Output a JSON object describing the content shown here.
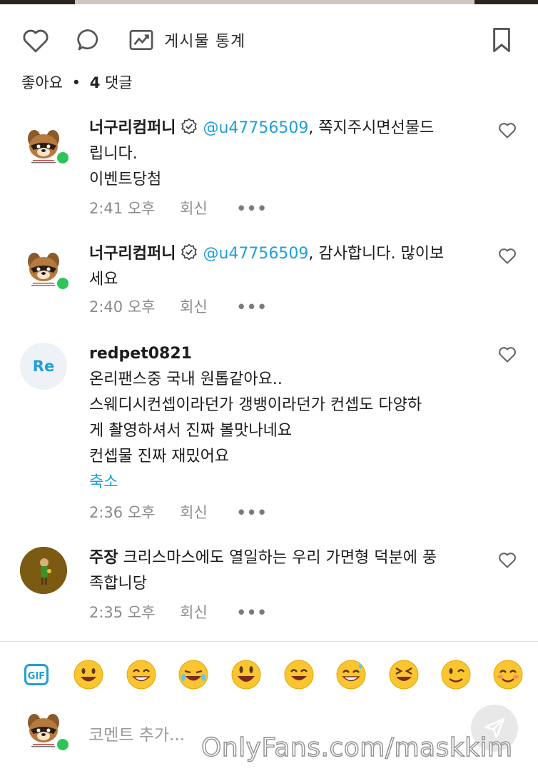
{
  "actions": {
    "stats_label": "게시물 통계"
  },
  "summary": {
    "likes_label": "좋아요",
    "separator": "•",
    "comments_count": "4",
    "comments_label": "댓글"
  },
  "comments": [
    {
      "author": "너구리컴퍼니",
      "mention": "@u47756509",
      "text_line1": ", 쪽지주시면선물드",
      "text_rest": "립니다.",
      "text_extra": "이벤트당첨",
      "time": "2:41 오후",
      "reply_label": "회신",
      "more": "•••"
    },
    {
      "author": "너구리컴퍼니",
      "mention": "@u47756509",
      "text_line1": ", 감사합니다. 많이보",
      "text_rest": "세요",
      "time": "2:40 오후",
      "reply_label": "회신",
      "more": "•••"
    },
    {
      "author": "redpet0821",
      "avatar_initials": "Re",
      "lines": [
        "온리팬스중 국내 원톱같아요..",
        "스웨디시컨셉이라던가 갱뱅이라던가 컨셉도 다양하",
        "게 촬영하셔서 진짜 볼맛나네요",
        "컨셉물 진짜 재밌어요"
      ],
      "collapse_label": "축소",
      "time": "2:36 오후",
      "reply_label": "회신",
      "more": "•••"
    },
    {
      "author": "주장",
      "text_line1": " 크리스마스에도 열일하는 우리 가면형 덕분에 풍",
      "text_rest": "족합니당",
      "time": "2:35 오후",
      "reply_label": "회신",
      "more": "•••"
    }
  ],
  "composer": {
    "placeholder": "코멘트 추가..."
  },
  "watermark": "OnlyFans.com/maskkim",
  "colors": {
    "accent": "#1f9fd8",
    "online": "#2ec45a",
    "meta": "#8a8a8a"
  },
  "icons": [
    "heart-icon",
    "comment-icon",
    "stats-icon",
    "bookmark-icon",
    "verified-icon",
    "gif-icon",
    "send-icon"
  ]
}
